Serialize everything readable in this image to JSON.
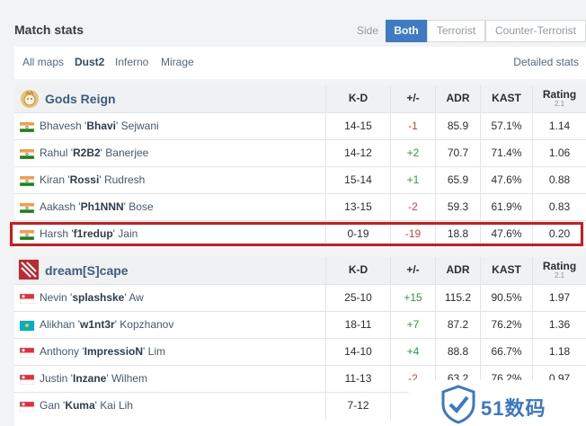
{
  "header": {
    "title": "Match stats",
    "side_label": "Side",
    "side_options": [
      {
        "label": "Both",
        "active": true
      },
      {
        "label": "Terrorist",
        "active": false
      },
      {
        "label": "Counter-Terrorist",
        "active": false
      }
    ]
  },
  "maps": {
    "items": [
      {
        "label": "All maps",
        "active": false
      },
      {
        "label": "Dust2",
        "active": true
      },
      {
        "label": "Inferno",
        "active": false
      },
      {
        "label": "Mirage",
        "active": false
      }
    ],
    "detailed_link": "Detailed stats"
  },
  "columns": {
    "kd": "K-D",
    "plus_minus": "+/-",
    "adr": "ADR",
    "kast": "KAST",
    "rating": "Rating",
    "rating_version": "2.1"
  },
  "teams": [
    {
      "name": "Gods Reign",
      "logo_icon": "lion-icon",
      "players": [
        {
          "first": "Bhavesh '",
          "nick": "Bhavi",
          "last": "' Sejwani",
          "flag": "india",
          "kd": "14-15",
          "pm": "-1",
          "adr": "85.9",
          "kast": "57.1%",
          "rating": "1.14"
        },
        {
          "first": "Rahul '",
          "nick": "R2B2",
          "last": "' Banerjee",
          "flag": "india",
          "kd": "14-12",
          "pm": "+2",
          "adr": "70.7",
          "kast": "71.4%",
          "rating": "1.06"
        },
        {
          "first": "Kiran '",
          "nick": "Rossi",
          "last": "' Rudresh",
          "flag": "india",
          "kd": "15-14",
          "pm": "+1",
          "adr": "65.9",
          "kast": "47.6%",
          "rating": "0.88"
        },
        {
          "first": "Aakash '",
          "nick": "Ph1NNN",
          "last": "' Bose",
          "flag": "india",
          "kd": "13-15",
          "pm": "-2",
          "adr": "59.3",
          "kast": "61.9%",
          "rating": "0.83"
        },
        {
          "first": "Harsh '",
          "nick": "f1redup",
          "last": "' Jain",
          "flag": "india",
          "kd": "0-19",
          "pm": "-19",
          "adr": "18.8",
          "kast": "47.6%",
          "rating": "0.20"
        }
      ]
    },
    {
      "name": "dream[S]cape",
      "logo_icon": "dreamscape-logo-icon",
      "players": [
        {
          "first": "Nevin '",
          "nick": "splashske",
          "last": "' Aw",
          "flag": "singapore",
          "kd": "25-10",
          "pm": "+15",
          "adr": "115.2",
          "kast": "90.5%",
          "rating": "1.97"
        },
        {
          "first": "Alikhan '",
          "nick": "w1nt3r",
          "last": "' Kopzhanov",
          "flag": "kazakhstan",
          "kd": "18-11",
          "pm": "+7",
          "adr": "87.2",
          "kast": "76.2%",
          "rating": "1.36"
        },
        {
          "first": "Anthony '",
          "nick": "ImpressioN",
          "last": "' Lim",
          "flag": "singapore",
          "kd": "14-10",
          "pm": "+4",
          "adr": "88.8",
          "kast": "66.7%",
          "rating": "1.18"
        },
        {
          "first": "Justin '",
          "nick": "Inzane",
          "last": "' Wilhem",
          "flag": "singapore",
          "kd": "11-13",
          "pm": "-2",
          "adr": "63.2",
          "kast": "76.2%",
          "rating": "0.97"
        },
        {
          "first": "Gan '",
          "nick": "Kuma",
          "last": "' Kai Lih",
          "flag": "singapore",
          "kd": "7-12",
          "pm": "",
          "adr": "",
          "kast": "",
          "rating": ""
        }
      ]
    }
  ],
  "watermark": {
    "text": "51数码",
    "icon": "shield-check-icon"
  },
  "colors": {
    "accent": "#3e7bc4",
    "positive": "#2e9b3f",
    "negative": "#d9423f",
    "highlight": "#d21a1a"
  }
}
